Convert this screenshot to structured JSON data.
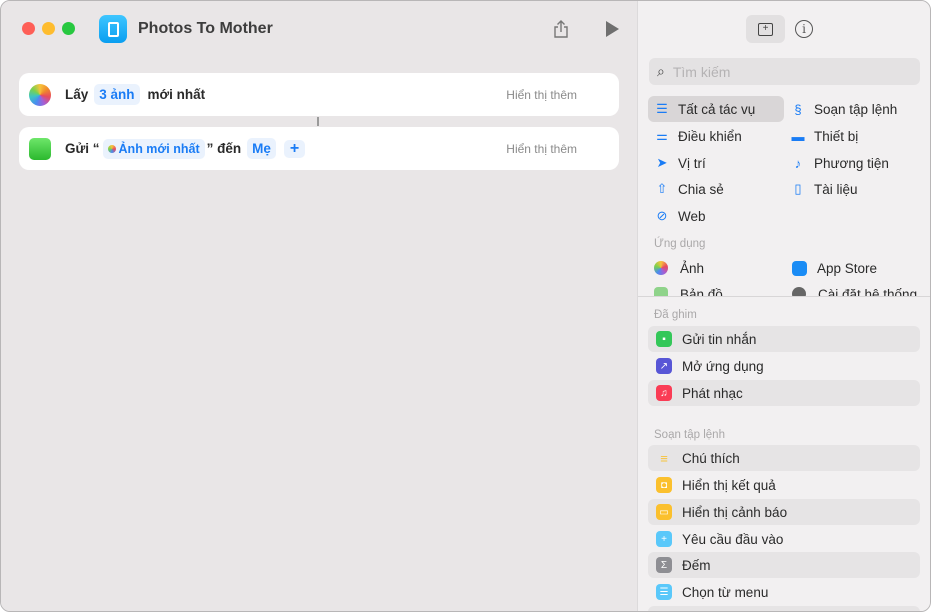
{
  "window": {
    "title": "Photos To Mother"
  },
  "actions": [
    {
      "verb": "Lấy",
      "token": "3 ảnh",
      "suffix": "mới nhất",
      "more": "Hiển thị thêm"
    },
    {
      "verb": "Gửi “",
      "token": "Ảnh mới nhất",
      "mid": "” đến",
      "recipient": "Mẹ",
      "add": "+",
      "more": "Hiển thị thêm"
    }
  ],
  "sidebar": {
    "search_placeholder": "Tìm kiếm",
    "categories": [
      "Tất cả tác vụ",
      "Soạn tập lệnh",
      "Điều khiển",
      "Thiết bị",
      "Vị trí",
      "Phương tiện",
      "Chia sẻ",
      "Tài liệu",
      "Web"
    ],
    "apps_header": "Ứng dụng",
    "apps": [
      "Ảnh",
      "App Store",
      "Bản đồ",
      "Cài đặt hệ thống"
    ],
    "pinned_header": "Đã ghim",
    "pinned": [
      "Gửi tin nhắn",
      "Mở ứng dụng",
      "Phát nhạc"
    ],
    "scripting_header": "Soạn tập lệnh",
    "scripting": [
      "Chú thích",
      "Hiển thị kết quả",
      "Hiển thị cảnh báo",
      "Yêu cầu đầu vào",
      "Đếm",
      "Chọn từ menu"
    ]
  },
  "colors": {
    "accent": "#1a7cf5"
  }
}
